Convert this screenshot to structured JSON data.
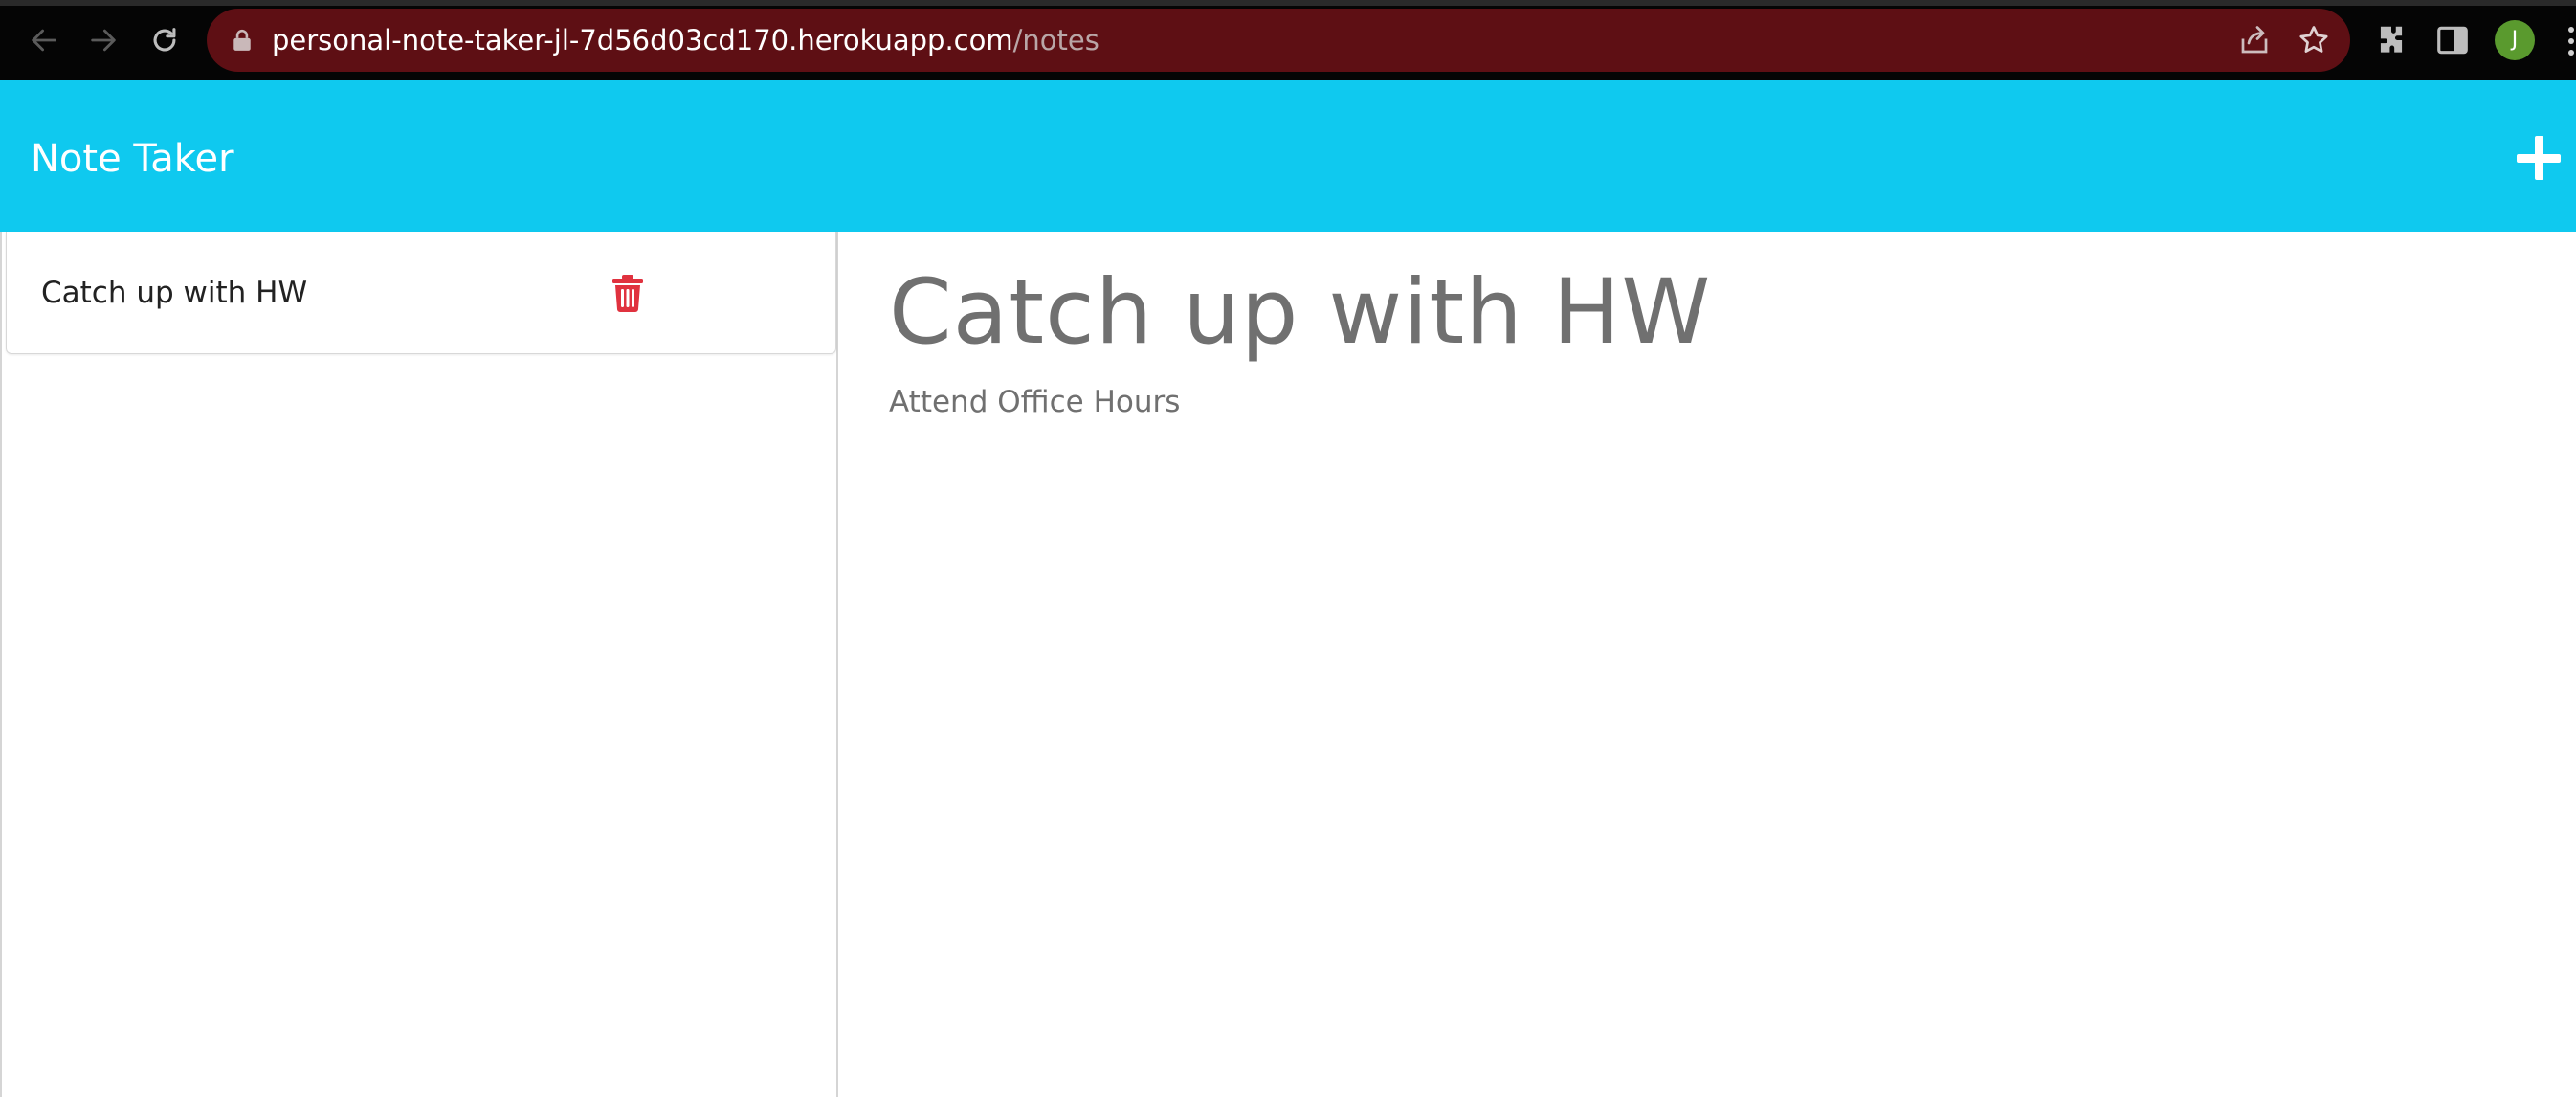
{
  "browser": {
    "url_host": "personal-note-taker-jl-7d56d03cd170.herokuapp.com",
    "url_path": "/notes",
    "profile_initial": "J",
    "omnibox_color": "#5e0f14"
  },
  "navbar": {
    "brand": "Note Taker",
    "background": "#0fc9ef",
    "new_note_icon": "plus-icon"
  },
  "notes": [
    {
      "title": "Catch up with HW",
      "delete_icon": "trash-icon",
      "delete_color": "#e0323f"
    }
  ],
  "active_note": {
    "title": "Catch up with HW",
    "text": "Attend Office Hours"
  }
}
